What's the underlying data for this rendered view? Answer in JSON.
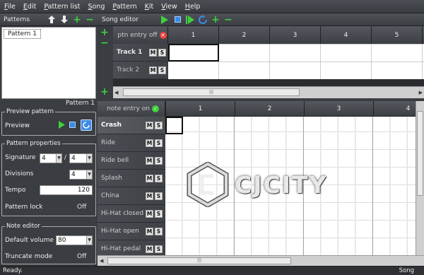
{
  "menu": [
    "File",
    "Edit",
    "Pattern list",
    "Song",
    "Pattern",
    "Kit",
    "View",
    "Help"
  ],
  "patterns_panel": {
    "title": "Patterns",
    "items": [
      "Pattern 1"
    ]
  },
  "song_editor": {
    "title": "Song editor",
    "ptn_entry": "ptn entry off",
    "columns": [
      "1",
      "2",
      "3",
      "4",
      "5"
    ],
    "tracks": [
      {
        "name": "Track 1",
        "mute": "M",
        "solo": "S"
      },
      {
        "name": "Track 2",
        "mute": "M",
        "solo": "S"
      }
    ]
  },
  "current_pattern": "Pattern 1",
  "preview": {
    "title": "Preview pattern",
    "label": "Preview"
  },
  "pattern_properties": {
    "title": "Pattern properties",
    "signature_label": "Signature",
    "signature_num": "4",
    "signature_sep": "/",
    "signature_den": "4",
    "divisions_label": "Divisions",
    "divisions_value": "4",
    "tempo_label": "Tempo",
    "tempo_value": "120",
    "lock_label": "Pattern lock",
    "lock_value": "Off"
  },
  "note_editor": {
    "title": "Note editor",
    "volume_label": "Default volume",
    "volume_value": "80",
    "truncate_label": "Truncate mode",
    "truncate_value": "Off"
  },
  "pattern_editor": {
    "note_entry": "note entry on",
    "columns": [
      "1",
      "2",
      "3",
      "4"
    ],
    "instruments": [
      "Crash",
      "Ride",
      "Ride bell",
      "Splash",
      "China",
      "Hi-Hat closed",
      "Hi-Hat open",
      "Hi-Hat pedal"
    ],
    "mute": "M",
    "solo": "S"
  },
  "watermark": "CJCITY",
  "status": {
    "left": "Ready.",
    "right": "Song"
  },
  "colors": {
    "accent_green": "#3fd13f",
    "accent_blue": "#3c8be8",
    "selected_bg": "#ffffff"
  }
}
